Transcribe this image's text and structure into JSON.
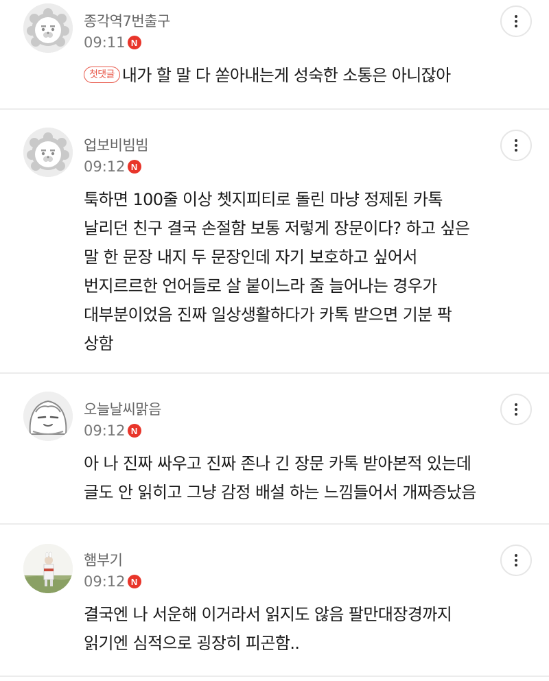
{
  "comments": [
    {
      "nickname": "종각역7번출구",
      "time": "09:11",
      "new_badge": "N",
      "first_badge": "첫댓글",
      "avatar": "ryan-lion-icon",
      "lines": [
        "내가 할 말 다 쏟아내는게 성숙한 소통은 아니잖아"
      ]
    },
    {
      "nickname": "업보비빔빔",
      "time": "09:12",
      "new_badge": "N",
      "avatar": "ryan-lion-icon",
      "lines": [
        "툭하면 100줄 이상 쳇지피티로 돌린 마냥 정제된 카톡",
        "날리던 친구 결국 손절함 보통 저렇게 장문이다? 하고 싶은",
        "말 한 문장 내지 두 문장인데 자기 보호하고 싶어서",
        "번지르르한 언어들로 살 붙이느라 줄 늘어나는 경우가",
        "대부분이었음 진짜 일상생활하다가 카톡 받으면 기분 팍",
        "상함"
      ]
    },
    {
      "nickname": "오늘날씨맑음",
      "time": "09:12",
      "new_badge": "N",
      "avatar": "smug-character-icon",
      "lines": [
        "아 나 진짜 싸우고 진짜 존나 긴 장문 카톡 받아본적 있는데",
        "글도 안 읽히고 그냥 감정 배설 하는 느낌들어서 개짜증났음"
      ]
    },
    {
      "nickname": "햄부기",
      "time": "09:12",
      "new_badge": "N",
      "avatar": "photo-avatar",
      "lines": [
        "결국엔 나 서운해 이거라서 읽지도 않음 팔만대장경까지",
        "읽기엔 심적으로 굉장히 피곤함.."
      ]
    }
  ]
}
